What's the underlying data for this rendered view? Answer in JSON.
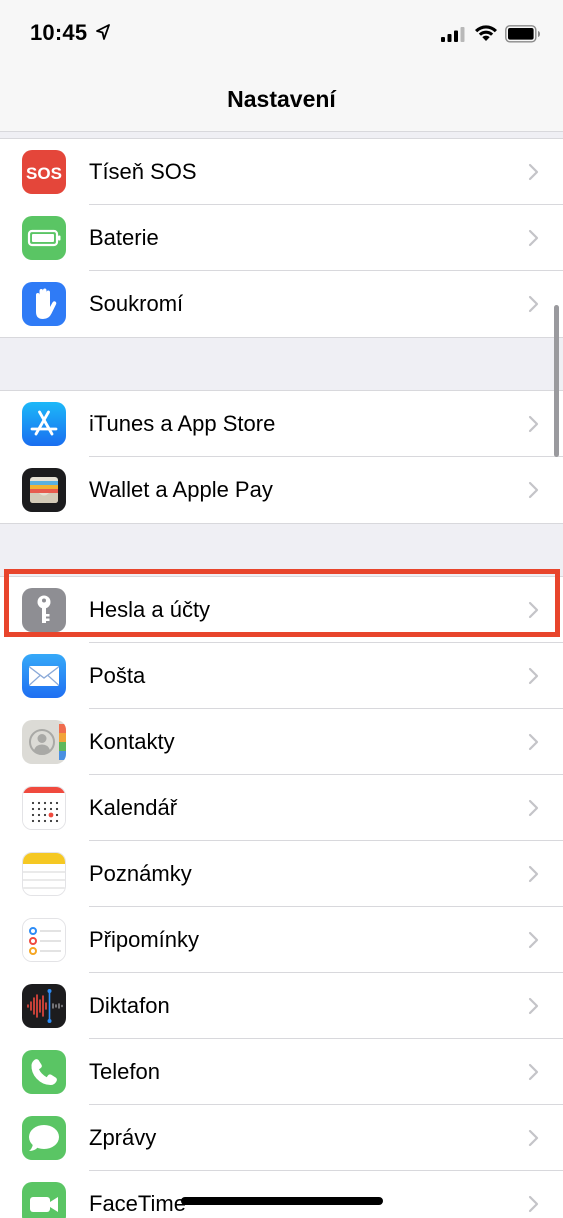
{
  "status_bar": {
    "time": "10:45",
    "icons": [
      "location-arrow-icon",
      "cellular-signal-icon",
      "wifi-icon",
      "battery-icon"
    ]
  },
  "nav": {
    "title": "Nastavení"
  },
  "groups": [
    {
      "rows": [
        {
          "id": "sos",
          "label": "Tíseň SOS",
          "icon": "sos-icon",
          "icon_text": "SOS",
          "color": "#e4463a"
        },
        {
          "id": "battery",
          "label": "Baterie",
          "icon": "battery-app-icon",
          "color": "#5ac564"
        },
        {
          "id": "privacy",
          "label": "Soukromí",
          "icon": "hand-icon",
          "color": "#2f7bf6"
        }
      ]
    },
    {
      "rows": [
        {
          "id": "itunes",
          "label": "iTunes a App Store",
          "icon": "app-store-icon",
          "color": "#1d8ef5"
        },
        {
          "id": "wallet",
          "label": "Wallet a Apple Pay",
          "icon": "wallet-icon",
          "color": "#1c1c1e"
        }
      ]
    },
    {
      "rows": [
        {
          "id": "passwords",
          "label": "Hesla a účty",
          "icon": "key-icon",
          "color": "#8e8e93",
          "highlighted": true
        },
        {
          "id": "mail",
          "label": "Pošta",
          "icon": "mail-icon",
          "color": "#2d8cf6"
        },
        {
          "id": "contacts",
          "label": "Kontakty",
          "icon": "contacts-icon",
          "color": "#d8d8d4"
        },
        {
          "id": "calendar",
          "label": "Kalendář",
          "icon": "calendar-icon",
          "color": "#ffffff"
        },
        {
          "id": "notes",
          "label": "Poznámky",
          "icon": "notes-icon",
          "color": "#f5c823"
        },
        {
          "id": "reminders",
          "label": "Připomínky",
          "icon": "reminders-icon",
          "color": "#ffffff"
        },
        {
          "id": "voicememos",
          "label": "Diktafon",
          "icon": "voice-memos-icon",
          "color": "#1c1c1e"
        },
        {
          "id": "phone",
          "label": "Telefon",
          "icon": "phone-icon",
          "color": "#5ac564"
        },
        {
          "id": "messages",
          "label": "Zprávy",
          "icon": "messages-icon",
          "color": "#5ac564"
        },
        {
          "id": "facetime",
          "label": "FaceTime",
          "icon": "facetime-icon",
          "color": "#5ac564"
        }
      ]
    }
  ],
  "highlight_color": "#e8452c"
}
